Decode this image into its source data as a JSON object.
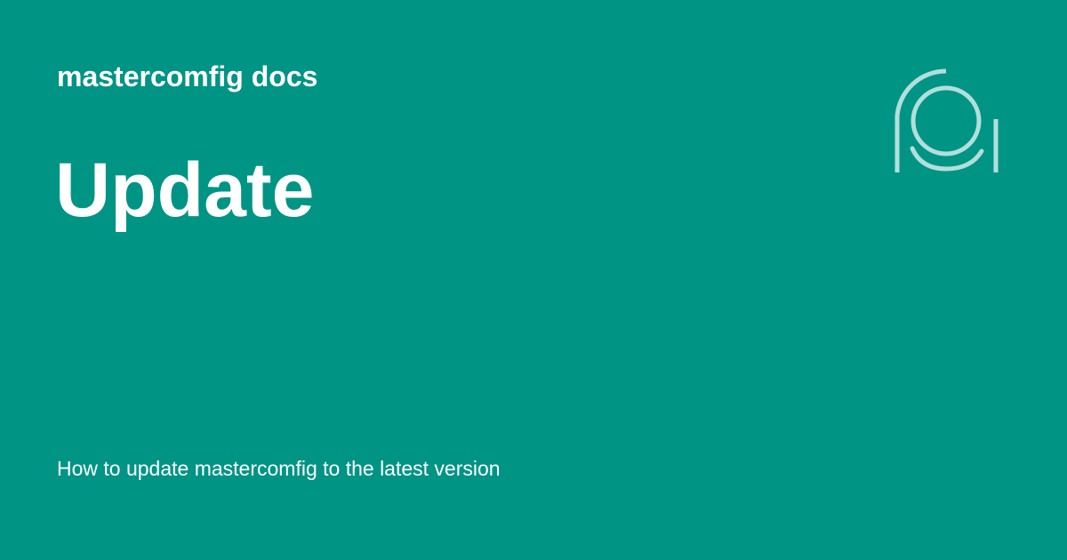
{
  "header": {
    "site_name": "mastercomfig docs"
  },
  "main": {
    "title": "Update",
    "description": "How to update mastercomfig to the latest version"
  },
  "logo": {
    "icon": "mastercomfig-logo-icon"
  },
  "colors": {
    "background": "#009485",
    "text": "#ffffff",
    "logo_stroke": "#b2dfdb"
  }
}
